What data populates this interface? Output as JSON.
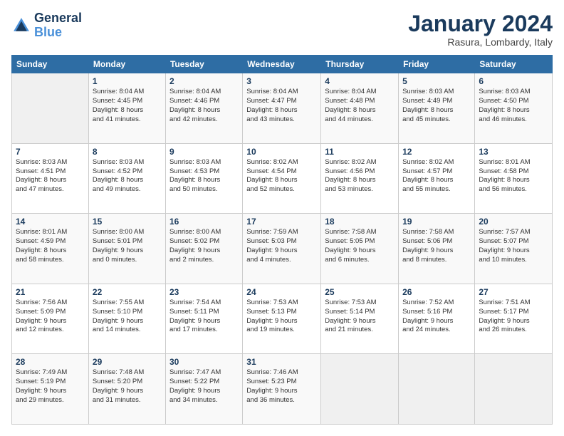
{
  "header": {
    "logo_line1": "General",
    "logo_line2": "Blue",
    "month_title": "January 2024",
    "location": "Rasura, Lombardy, Italy"
  },
  "weekdays": [
    "Sunday",
    "Monday",
    "Tuesday",
    "Wednesday",
    "Thursday",
    "Friday",
    "Saturday"
  ],
  "weeks": [
    [
      {
        "day": "",
        "info": ""
      },
      {
        "day": "1",
        "info": "Sunrise: 8:04 AM\nSunset: 4:45 PM\nDaylight: 8 hours\nand 41 minutes."
      },
      {
        "day": "2",
        "info": "Sunrise: 8:04 AM\nSunset: 4:46 PM\nDaylight: 8 hours\nand 42 minutes."
      },
      {
        "day": "3",
        "info": "Sunrise: 8:04 AM\nSunset: 4:47 PM\nDaylight: 8 hours\nand 43 minutes."
      },
      {
        "day": "4",
        "info": "Sunrise: 8:04 AM\nSunset: 4:48 PM\nDaylight: 8 hours\nand 44 minutes."
      },
      {
        "day": "5",
        "info": "Sunrise: 8:03 AM\nSunset: 4:49 PM\nDaylight: 8 hours\nand 45 minutes."
      },
      {
        "day": "6",
        "info": "Sunrise: 8:03 AM\nSunset: 4:50 PM\nDaylight: 8 hours\nand 46 minutes."
      }
    ],
    [
      {
        "day": "7",
        "info": "Sunrise: 8:03 AM\nSunset: 4:51 PM\nDaylight: 8 hours\nand 47 minutes."
      },
      {
        "day": "8",
        "info": "Sunrise: 8:03 AM\nSunset: 4:52 PM\nDaylight: 8 hours\nand 49 minutes."
      },
      {
        "day": "9",
        "info": "Sunrise: 8:03 AM\nSunset: 4:53 PM\nDaylight: 8 hours\nand 50 minutes."
      },
      {
        "day": "10",
        "info": "Sunrise: 8:02 AM\nSunset: 4:54 PM\nDaylight: 8 hours\nand 52 minutes."
      },
      {
        "day": "11",
        "info": "Sunrise: 8:02 AM\nSunset: 4:56 PM\nDaylight: 8 hours\nand 53 minutes."
      },
      {
        "day": "12",
        "info": "Sunrise: 8:02 AM\nSunset: 4:57 PM\nDaylight: 8 hours\nand 55 minutes."
      },
      {
        "day": "13",
        "info": "Sunrise: 8:01 AM\nSunset: 4:58 PM\nDaylight: 8 hours\nand 56 minutes."
      }
    ],
    [
      {
        "day": "14",
        "info": "Sunrise: 8:01 AM\nSunset: 4:59 PM\nDaylight: 8 hours\nand 58 minutes."
      },
      {
        "day": "15",
        "info": "Sunrise: 8:00 AM\nSunset: 5:01 PM\nDaylight: 9 hours\nand 0 minutes."
      },
      {
        "day": "16",
        "info": "Sunrise: 8:00 AM\nSunset: 5:02 PM\nDaylight: 9 hours\nand 2 minutes."
      },
      {
        "day": "17",
        "info": "Sunrise: 7:59 AM\nSunset: 5:03 PM\nDaylight: 9 hours\nand 4 minutes."
      },
      {
        "day": "18",
        "info": "Sunrise: 7:58 AM\nSunset: 5:05 PM\nDaylight: 9 hours\nand 6 minutes."
      },
      {
        "day": "19",
        "info": "Sunrise: 7:58 AM\nSunset: 5:06 PM\nDaylight: 9 hours\nand 8 minutes."
      },
      {
        "day": "20",
        "info": "Sunrise: 7:57 AM\nSunset: 5:07 PM\nDaylight: 9 hours\nand 10 minutes."
      }
    ],
    [
      {
        "day": "21",
        "info": "Sunrise: 7:56 AM\nSunset: 5:09 PM\nDaylight: 9 hours\nand 12 minutes."
      },
      {
        "day": "22",
        "info": "Sunrise: 7:55 AM\nSunset: 5:10 PM\nDaylight: 9 hours\nand 14 minutes."
      },
      {
        "day": "23",
        "info": "Sunrise: 7:54 AM\nSunset: 5:11 PM\nDaylight: 9 hours\nand 17 minutes."
      },
      {
        "day": "24",
        "info": "Sunrise: 7:53 AM\nSunset: 5:13 PM\nDaylight: 9 hours\nand 19 minutes."
      },
      {
        "day": "25",
        "info": "Sunrise: 7:53 AM\nSunset: 5:14 PM\nDaylight: 9 hours\nand 21 minutes."
      },
      {
        "day": "26",
        "info": "Sunrise: 7:52 AM\nSunset: 5:16 PM\nDaylight: 9 hours\nand 24 minutes."
      },
      {
        "day": "27",
        "info": "Sunrise: 7:51 AM\nSunset: 5:17 PM\nDaylight: 9 hours\nand 26 minutes."
      }
    ],
    [
      {
        "day": "28",
        "info": "Sunrise: 7:49 AM\nSunset: 5:19 PM\nDaylight: 9 hours\nand 29 minutes."
      },
      {
        "day": "29",
        "info": "Sunrise: 7:48 AM\nSunset: 5:20 PM\nDaylight: 9 hours\nand 31 minutes."
      },
      {
        "day": "30",
        "info": "Sunrise: 7:47 AM\nSunset: 5:22 PM\nDaylight: 9 hours\nand 34 minutes."
      },
      {
        "day": "31",
        "info": "Sunrise: 7:46 AM\nSunset: 5:23 PM\nDaylight: 9 hours\nand 36 minutes."
      },
      {
        "day": "",
        "info": ""
      },
      {
        "day": "",
        "info": ""
      },
      {
        "day": "",
        "info": ""
      }
    ]
  ]
}
